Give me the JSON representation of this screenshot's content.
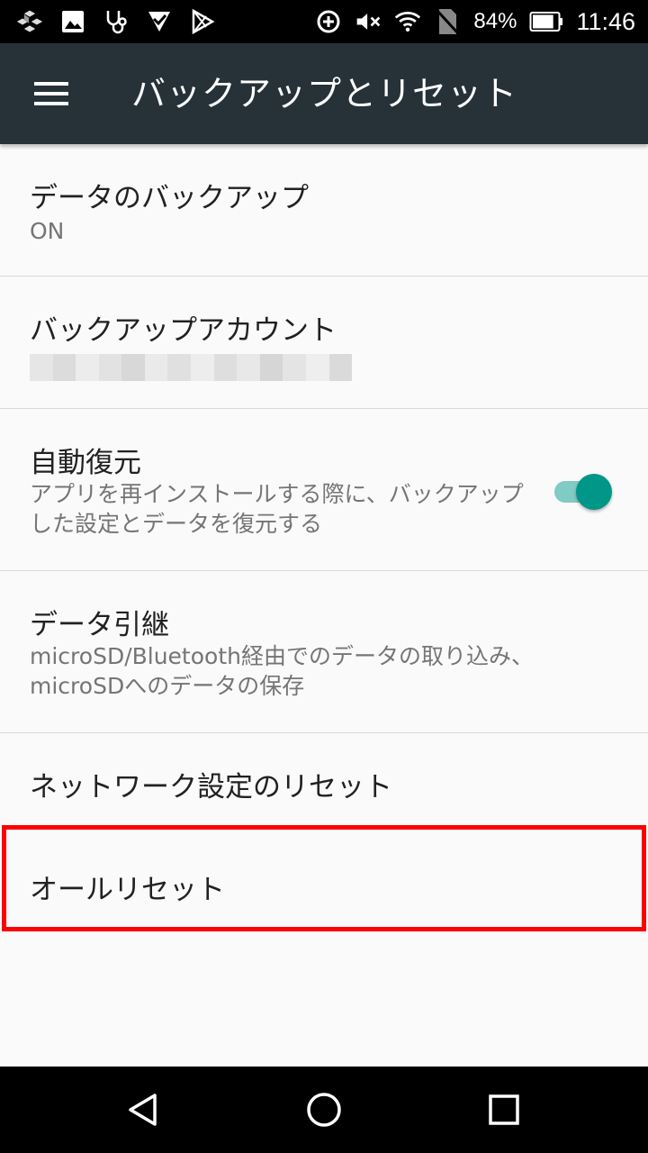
{
  "status_bar": {
    "icons_left": [
      "app-cube-icon",
      "image-icon",
      "stethoscope-icon",
      "checkmark-app-icon",
      "play-store-icon"
    ],
    "icons_right": [
      "data-saver-icon",
      "mute-icon",
      "wifi-icon",
      "no-sim-icon"
    ],
    "battery_percent": "84%",
    "battery_level": 0.84,
    "time": "11:46"
  },
  "app_bar": {
    "menu_icon": "menu-icon",
    "title": "バックアップとリセット",
    "color": "#263238"
  },
  "settings": {
    "backup": {
      "title": "データのバックアップ",
      "subtitle": "ON"
    },
    "account": {
      "title": "バックアップアカウント"
    },
    "auto_restore": {
      "title": "自動復元",
      "subtitle": "アプリを再インストールする際に、バックアップした設定とデータを復元する",
      "toggle_on": true,
      "accent": "#009688"
    },
    "transfer": {
      "title": "データ引継",
      "subtitle": "microSD/Bluetooth経由でのデータの取り込み、microSDへのデータの保存"
    },
    "network_reset": {
      "title": "ネットワーク設定のリセット"
    },
    "all_reset": {
      "title": "オールリセット",
      "highlight_color": "#ff0000"
    }
  },
  "nav_bar": {
    "back": "back-icon",
    "home": "home-icon",
    "recents": "recents-icon"
  }
}
